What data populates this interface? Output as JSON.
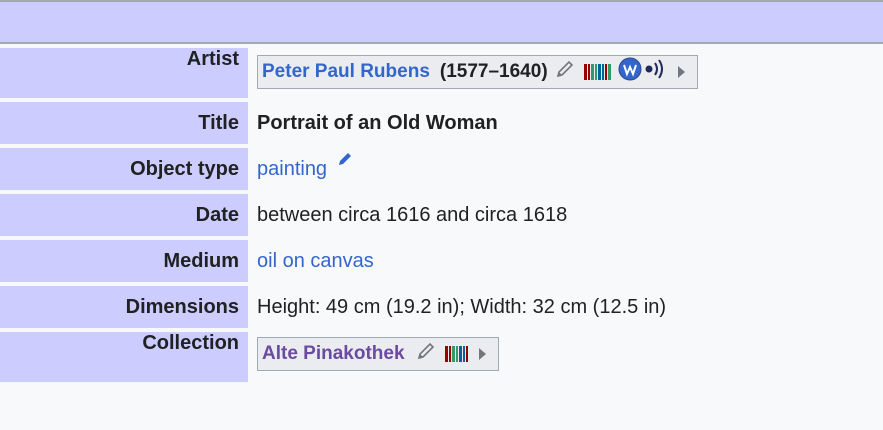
{
  "rows": {
    "artist": {
      "label": "Artist",
      "name": "Peter Paul Rubens",
      "years": "(1577–1640)"
    },
    "title": {
      "label": "Title",
      "value": "Portrait of an Old Woman"
    },
    "object_type": {
      "label": "Object type",
      "value": "painting"
    },
    "date": {
      "label": "Date",
      "value": "between circa 1616 and circa 1618"
    },
    "medium": {
      "label": "Medium",
      "value": "oil on canvas"
    },
    "dimensions": {
      "label": "Dimensions",
      "value": "Height: 49 cm (19.2 in); Width: 32 cm (12.5 in)"
    },
    "collection": {
      "label": "Collection",
      "name": "Alte Pinakothek"
    }
  },
  "icons": {
    "edit": "pencil-icon",
    "wikidata": "wikidata-barcode-icon",
    "wikisource": "wikisource-icon",
    "audio": "audio-icon",
    "expand": "expand-triangle-icon"
  },
  "colors": {
    "header_bg": "#ccccff",
    "link": "#3366cc",
    "visited_link": "#6b4ba1",
    "text": "#202122"
  }
}
